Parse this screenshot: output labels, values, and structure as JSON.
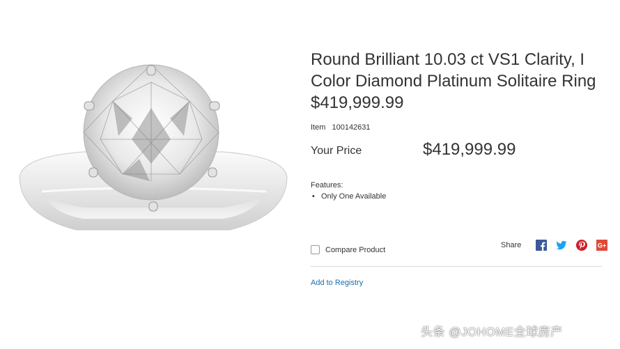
{
  "product": {
    "title": "Round Brilliant 10.03 ct VS1 Clarity, I Color Diamond Platinum Solitaire Ring $419,999.99",
    "item_label": "Item",
    "item_number": "100142631",
    "price_label": "Your Price",
    "price": "$419,999.99",
    "features_label": "Features:",
    "features": [
      "Only One Available"
    ]
  },
  "actions": {
    "compare_label": "Compare Product",
    "share_label": "Share",
    "share_icons": [
      "facebook-icon",
      "twitter-icon",
      "pinterest-icon",
      "google-plus-icon"
    ],
    "registry_label": "Add to Registry"
  },
  "watermark": "头条 @JOHOME全球房产",
  "colors": {
    "text": "#333333",
    "link": "#1a6ea8",
    "facebook": "#3b5998",
    "twitter": "#1da1f2",
    "pinterest": "#cb2027",
    "google_plus": "#dd4b39"
  }
}
